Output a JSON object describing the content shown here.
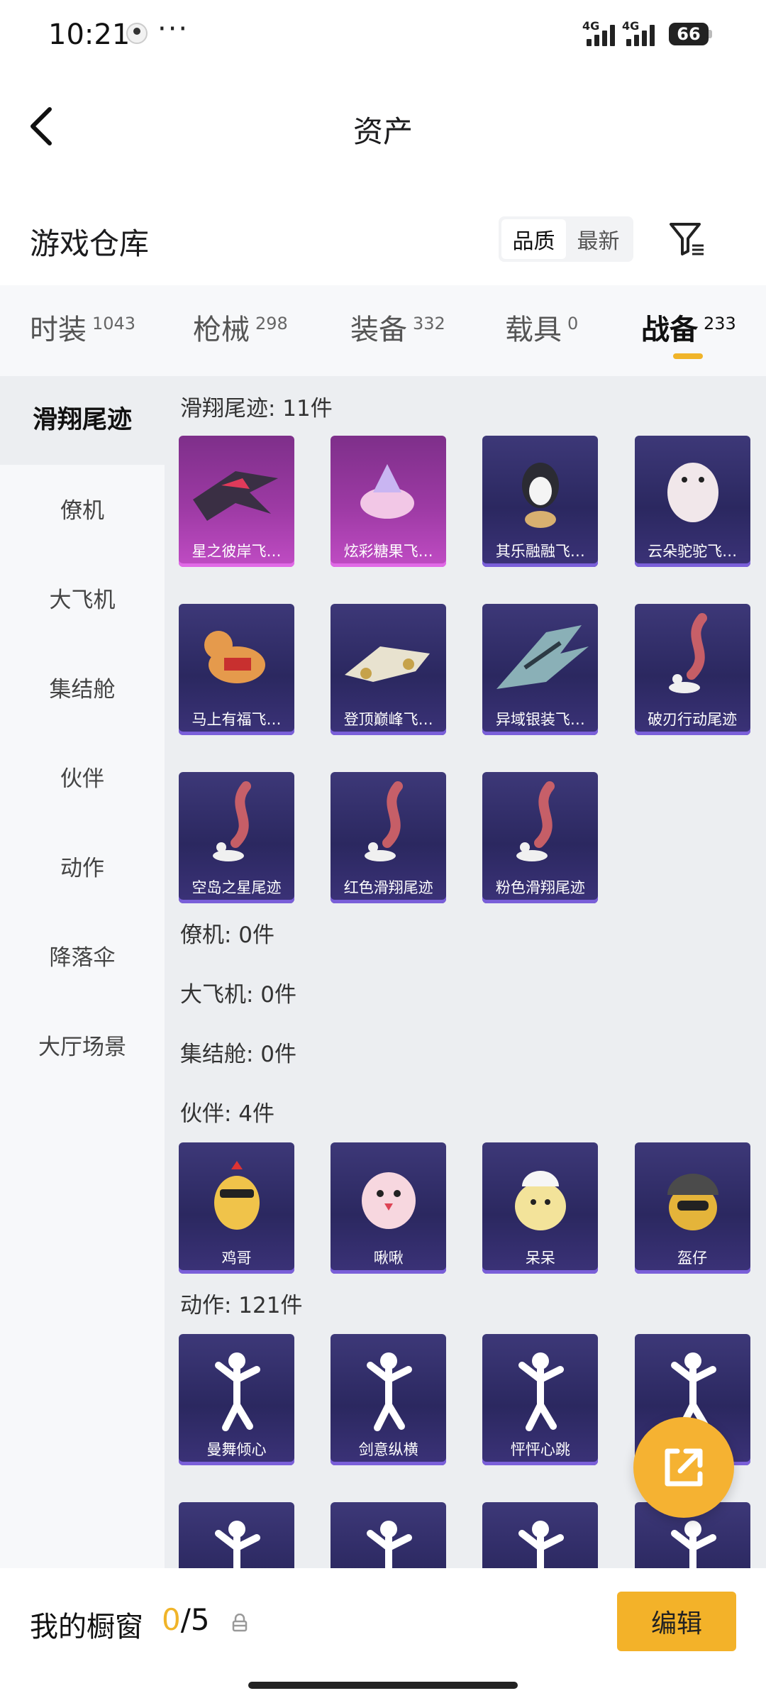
{
  "status_bar": {
    "time": "10:21",
    "more": "···",
    "net1": "4G",
    "net2": "4G",
    "battery": "66"
  },
  "header": {
    "title": "资产"
  },
  "warehouse": {
    "title": "游戏仓库",
    "sort_options": [
      "品质",
      "最新"
    ],
    "active_sort": "品质"
  },
  "tabs": [
    {
      "label": "时装",
      "count": "1043"
    },
    {
      "label": "枪械",
      "count": "298"
    },
    {
      "label": "装备",
      "count": "332"
    },
    {
      "label": "载具",
      "count": "0"
    },
    {
      "label": "战备",
      "count": "233"
    }
  ],
  "active_tab": "战备",
  "sidebar": [
    "滑翔尾迹",
    "僚机",
    "大飞机",
    "集结舱",
    "伙伴",
    "动作",
    "降落伞",
    "大厅场景"
  ],
  "active_sidebar": "滑翔尾迹",
  "sections": [
    {
      "title": "滑翔尾迹: 11件",
      "items": [
        {
          "label": "星之彼岸飞…",
          "art": "spaceship-icon",
          "rarity": "pink"
        },
        {
          "label": "炫彩糖果飞…",
          "art": "candy-icon",
          "rarity": "pink"
        },
        {
          "label": "其乐融融飞…",
          "art": "penguin-icon",
          "rarity": "purple"
        },
        {
          "label": "云朵驼驼飞…",
          "art": "alpaca-icon",
          "rarity": "purple"
        },
        {
          "label": "马上有福飞…",
          "art": "horse-icon",
          "rarity": "purple"
        },
        {
          "label": "登顶巅峰飞…",
          "art": "plane-icon",
          "rarity": "purple"
        },
        {
          "label": "异域银装飞…",
          "art": "wing-icon",
          "rarity": "purple"
        },
        {
          "label": "破刃行动尾迹",
          "art": "trail-icon",
          "rarity": "purple"
        },
        {
          "label": "空岛之星尾迹",
          "art": "trail-icon",
          "rarity": "purple"
        },
        {
          "label": "红色滑翔尾迹",
          "art": "trail-icon",
          "rarity": "purple"
        },
        {
          "label": "粉色滑翔尾迹",
          "art": "trail-icon",
          "rarity": "purple"
        }
      ]
    },
    {
      "title": "僚机: 0件",
      "items": []
    },
    {
      "title": "大飞机: 0件",
      "items": []
    },
    {
      "title": "集结舱: 0件",
      "items": []
    },
    {
      "title": "伙伴: 4件",
      "items": [
        {
          "label": "鸡哥",
          "art": "chicken-icon",
          "rarity": "purple"
        },
        {
          "label": "啾啾",
          "art": "bird-icon",
          "rarity": "purple"
        },
        {
          "label": "呆呆",
          "art": "chick-icon",
          "rarity": "purple"
        },
        {
          "label": "盔仔",
          "art": "helmet-chick-icon",
          "rarity": "purple"
        }
      ]
    },
    {
      "title": "动作: 121件",
      "items": [
        {
          "label": "曼舞倾心",
          "art": "dance-icon",
          "rarity": "purple"
        },
        {
          "label": "剑意纵横",
          "art": "dance-icon",
          "rarity": "purple"
        },
        {
          "label": "怦怦心跳",
          "art": "dance-icon",
          "rarity": "purple"
        },
        {
          "label": "",
          "art": "dance-icon",
          "rarity": "purple"
        },
        {
          "label": "",
          "art": "dance-icon",
          "rarity": "purple"
        },
        {
          "label": "",
          "art": "dance-icon",
          "rarity": "purple"
        },
        {
          "label": "",
          "art": "dance-icon",
          "rarity": "purple"
        },
        {
          "label": "",
          "art": "dance-icon",
          "rarity": "purple"
        }
      ]
    }
  ],
  "showcase": {
    "label": "我的橱窗",
    "current": "0",
    "separator": "/",
    "max": "5",
    "edit_label": "编辑"
  },
  "colors": {
    "accent": "#f0b429",
    "card_purple": "#2b2860",
    "card_pink": "#9d3aa4"
  }
}
